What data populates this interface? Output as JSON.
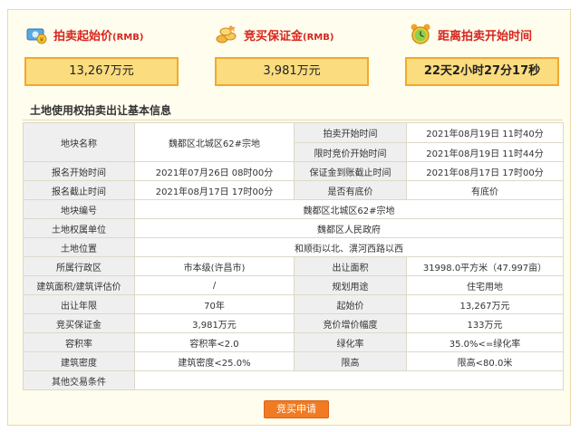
{
  "stats": [
    {
      "label": "拍卖起始价",
      "sub": "(RMB)",
      "value": "13,267万元",
      "icon": "money-icon"
    },
    {
      "label": "竞买保证金",
      "sub": "(RMB)",
      "value": "3,981万元",
      "icon": "coins-icon"
    },
    {
      "label": "距离拍卖开始时间",
      "sub": "",
      "value": "22天2小时27分17秒",
      "icon": "alarm-clock-icon"
    }
  ],
  "section_title": "土地使用权拍卖出让基本信息",
  "table": {
    "parcel_name_label": "地块名称",
    "parcel_name": "魏都区北城区62#宗地",
    "auction_start_label": "拍卖开始时间",
    "auction_start": "2021年08月19日 11时40分",
    "limit_start_label": "限时竞价开始时间",
    "limit_start": "2021年08月19日 11时44分",
    "reg_start_label": "报名开始时间",
    "reg_start": "2021年07月26日 08时00分",
    "deposit_deadline_label": "保证金到账截止时间",
    "deposit_deadline": "2021年08月17日 17时00分",
    "reg_end_label": "报名截止时间",
    "reg_end": "2021年08月17日 17时00分",
    "reserve_label": "是否有底价",
    "reserve": "有底价",
    "parcel_no_label": "地块编号",
    "parcel_no": "魏都区北城区62#宗地",
    "owner_label": "土地权属单位",
    "owner": "魏都区人民政府",
    "location_label": "土地位置",
    "location": "和顺街以北、潩河西路以西",
    "district_label": "所属行政区",
    "district": "市本级(许昌市)",
    "area_label": "出让面积",
    "area": "31998.0平方米（47.997亩）",
    "building_area_label": "建筑面积/建筑评估价",
    "building_area": "/",
    "use_label": "规划用途",
    "use": "住宅用地",
    "term_label": "出让年限",
    "term": "70年",
    "start_price_label": "起始价",
    "start_price": "13,267万元",
    "deposit_label": "竞买保证金",
    "deposit": "3,981万元",
    "increment_label": "竞价增价幅度",
    "increment": "133万元",
    "far_label": "容积率",
    "far": "容积率<2.0",
    "green_label": "绿化率",
    "green": "35.0%<=绿化率",
    "density_label": "建筑密度",
    "density": "建筑密度<25.0%",
    "height_label": "限高",
    "height": "限高<80.0米",
    "other_label": "其他交易条件",
    "other": ""
  },
  "button_label": "竞买申请"
}
